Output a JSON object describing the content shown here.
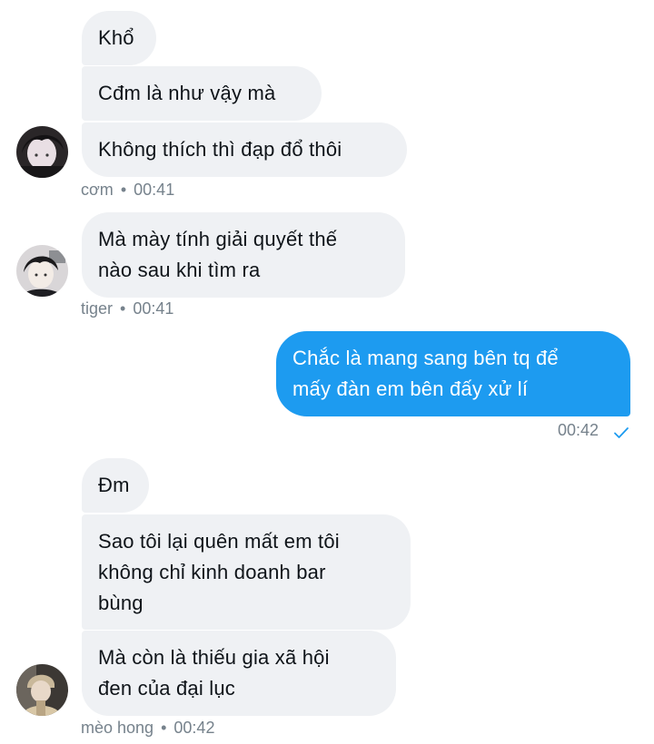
{
  "conversation": {
    "group1": {
      "messages": [
        {
          "text": "Khổ"
        },
        {
          "text": "Cđm là như vậy mà"
        },
        {
          "text": "Không thích thì đạp đổ thôi"
        }
      ],
      "sender": "cơm",
      "separator": "•",
      "time": "00:41",
      "avatar_icon": "user-avatar-icon"
    },
    "group2": {
      "messages": [
        {
          "text": "Mà mày tính giải quyết thế\nnào sau khi tìm ra"
        }
      ],
      "sender": "tiger",
      "separator": "•",
      "time": "00:41",
      "avatar_icon": "user-avatar-icon"
    },
    "outgoing": {
      "messages": [
        {
          "text": "Chắc là mang sang bên tq để\nmấy đàn em bên đấy xử lí"
        }
      ],
      "time": "00:42",
      "status_icon": "check-icon"
    },
    "group3": {
      "messages": [
        {
          "text": "Đm"
        },
        {
          "text": "Sao tôi lại quên mất em tôi\nkhông chỉ kinh doanh bar\nbùng"
        },
        {
          "text": "Mà còn là thiếu gia xã hội\nđen của đại lục"
        }
      ],
      "sender": "mèo hong",
      "separator": "•",
      "time": "00:42",
      "avatar_icon": "user-avatar-icon"
    }
  },
  "colors": {
    "incoming_bubble": "#eff1f4",
    "outgoing_bubble": "#1d9bf0",
    "meta_text": "#76828c",
    "check": "#1d9bf0"
  }
}
